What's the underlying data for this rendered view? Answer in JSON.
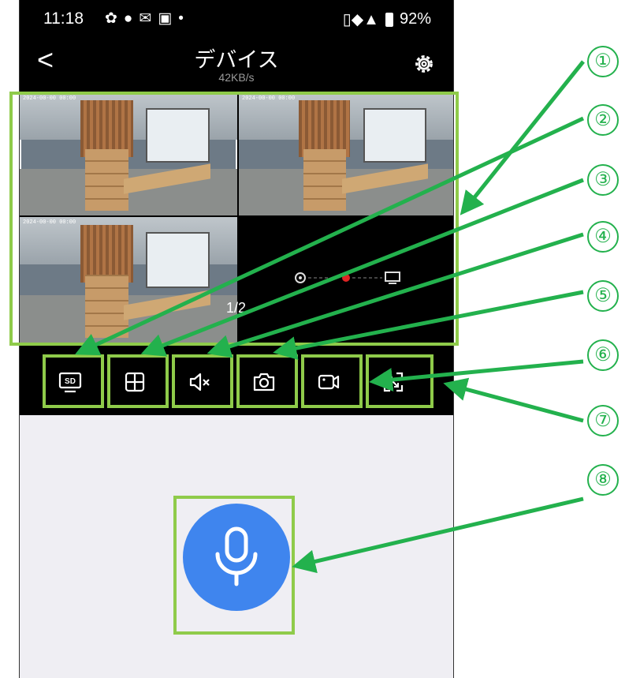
{
  "status_bar": {
    "time": "11:18",
    "battery_percent": "92%",
    "icons": [
      "gear-icon",
      "circle-star-icon",
      "mail-icon",
      "app-icon",
      "dot-icon",
      "vibrate-icon",
      "wifi-icon",
      "signal-icon",
      "battery-icon"
    ]
  },
  "header": {
    "title": "デバイス",
    "speed": "42KB/s"
  },
  "video": {
    "page_indicator": "1/2"
  },
  "toolbar": {
    "buttons": [
      "sd-card",
      "grid-layout",
      "mute",
      "snapshot",
      "record",
      "fullscreen"
    ]
  },
  "callouts": [
    "①",
    "②",
    "③",
    "④",
    "⑤",
    "⑥",
    "⑦",
    "⑧"
  ],
  "colors": {
    "highlight": "#8fcb4a",
    "arrow": "#23b14d",
    "mic": "#3f85ee",
    "lower_bg": "#efeef3"
  }
}
